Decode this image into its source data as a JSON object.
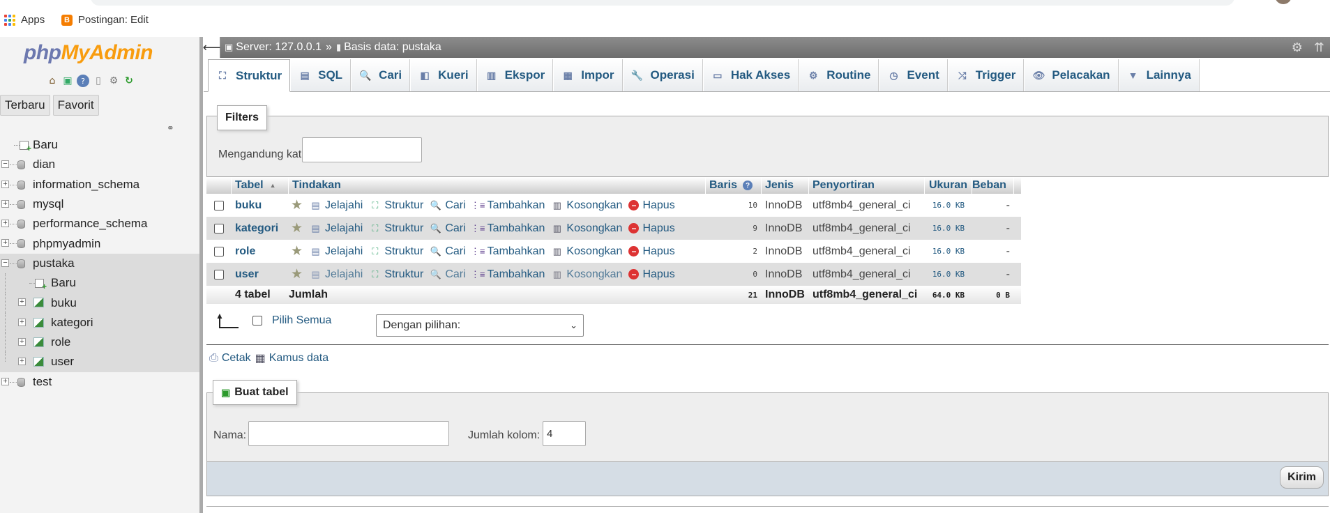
{
  "browser": {
    "bookmarks": [
      {
        "label": "Apps"
      },
      {
        "label": "Postingan: Edit"
      }
    ]
  },
  "navigation": {
    "logo": {
      "php": "php",
      "myadmin": "MyAdmin"
    },
    "tabs": [
      "Terbaru",
      "Favorit"
    ],
    "tree": [
      {
        "label": "Baru",
        "kind": "new",
        "level": 0
      },
      {
        "label": "dian",
        "kind": "db",
        "level": 0,
        "expanded": true
      },
      {
        "label": "information_schema",
        "kind": "db",
        "level": 0
      },
      {
        "label": "mysql",
        "kind": "db",
        "level": 0
      },
      {
        "label": "performance_schema",
        "kind": "db",
        "level": 0
      },
      {
        "label": "phpmyadmin",
        "kind": "db",
        "level": 0
      },
      {
        "label": "pustaka",
        "kind": "db",
        "level": 0,
        "expanded": true,
        "selected": true
      },
      {
        "label": "Baru",
        "kind": "new",
        "level": 1,
        "selected": true
      },
      {
        "label": "buku",
        "kind": "table",
        "level": 1,
        "selected": true
      },
      {
        "label": "kategori",
        "kind": "table",
        "level": 1,
        "selected": true
      },
      {
        "label": "role",
        "kind": "table",
        "level": 1,
        "selected": true
      },
      {
        "label": "user",
        "kind": "table",
        "level": 1,
        "selected": true
      },
      {
        "label": "test",
        "kind": "db",
        "level": 0
      }
    ]
  },
  "breadcrumb": {
    "server": "Server: 127.0.0.1",
    "separator": "»",
    "database": "Basis data: pustaka"
  },
  "topmenu": [
    {
      "label": "Struktur",
      "icon": "structure-icon",
      "glyph": "⛶",
      "active": true
    },
    {
      "label": "SQL",
      "icon": "sql-icon",
      "glyph": "▤"
    },
    {
      "label": "Cari",
      "icon": "search-icon",
      "glyph": "🔍"
    },
    {
      "label": "Kueri",
      "icon": "query-icon",
      "glyph": "◧"
    },
    {
      "label": "Ekspor",
      "icon": "export-icon",
      "glyph": "▥"
    },
    {
      "label": "Impor",
      "icon": "import-icon",
      "glyph": "▦"
    },
    {
      "label": "Operasi",
      "icon": "wrench-icon",
      "glyph": "🔧"
    },
    {
      "label": "Hak Akses",
      "icon": "privileges-icon",
      "glyph": "▭"
    },
    {
      "label": "Routine",
      "icon": "routines-icon",
      "glyph": "⚙"
    },
    {
      "label": "Event",
      "icon": "event-icon",
      "glyph": "◷"
    },
    {
      "label": "Trigger",
      "icon": "trigger-icon",
      "glyph": "⤮"
    },
    {
      "label": "Pelacakan",
      "icon": "tracking-eye-icon",
      "glyph": "👁"
    },
    {
      "label": "Lainnya",
      "icon": "more-chevron-icon",
      "glyph": "▼"
    }
  ],
  "filters": {
    "legend": "Filters",
    "label": "Mengandung kata:",
    "value": ""
  },
  "table": {
    "headers": {
      "tabel": "Tabel",
      "tindakan": "Tindakan",
      "baris": "Baris",
      "jenis": "Jenis",
      "penyortiran": "Penyortiran",
      "ukuran": "Ukuran",
      "beban": "Beban"
    },
    "actions": {
      "jelajahi": "Jelajahi",
      "struktur": "Struktur",
      "cari": "Cari",
      "tambahkan": "Tambahkan",
      "kosongkan": "Kosongkan",
      "hapus": "Hapus"
    },
    "rows": [
      {
        "name": "buku",
        "rows": "10",
        "engine": "InnoDB",
        "collation": "utf8mb4_general_ci",
        "size": "16.0 KB",
        "overhead": "-"
      },
      {
        "name": "kategori",
        "rows": "9",
        "engine": "InnoDB",
        "collation": "utf8mb4_general_ci",
        "size": "16.0 KB",
        "overhead": "-"
      },
      {
        "name": "role",
        "rows": "2",
        "engine": "InnoDB",
        "collation": "utf8mb4_general_ci",
        "size": "16.0 KB",
        "overhead": "-"
      },
      {
        "name": "user",
        "rows": "0",
        "engine": "InnoDB",
        "collation": "utf8mb4_general_ci",
        "size": "16.0 KB",
        "overhead": "-"
      }
    ],
    "footer": {
      "count": "4 tabel",
      "label": "Jumlah",
      "rows": "21",
      "engine": "InnoDB",
      "collation": "utf8mb4_general_ci",
      "size": "64.0 KB",
      "overhead": "0 B"
    }
  },
  "bulk": {
    "select_all": "Pilih Semua",
    "with_selected": "Dengan pilihan:"
  },
  "links": {
    "print": "Cetak",
    "dictionary": "Kamus data"
  },
  "create": {
    "legend": "Buat tabel",
    "name_label": "Nama:",
    "name_value": "",
    "cols_label": "Jumlah kolom:",
    "cols_value": "4",
    "submit": "Kirim"
  }
}
